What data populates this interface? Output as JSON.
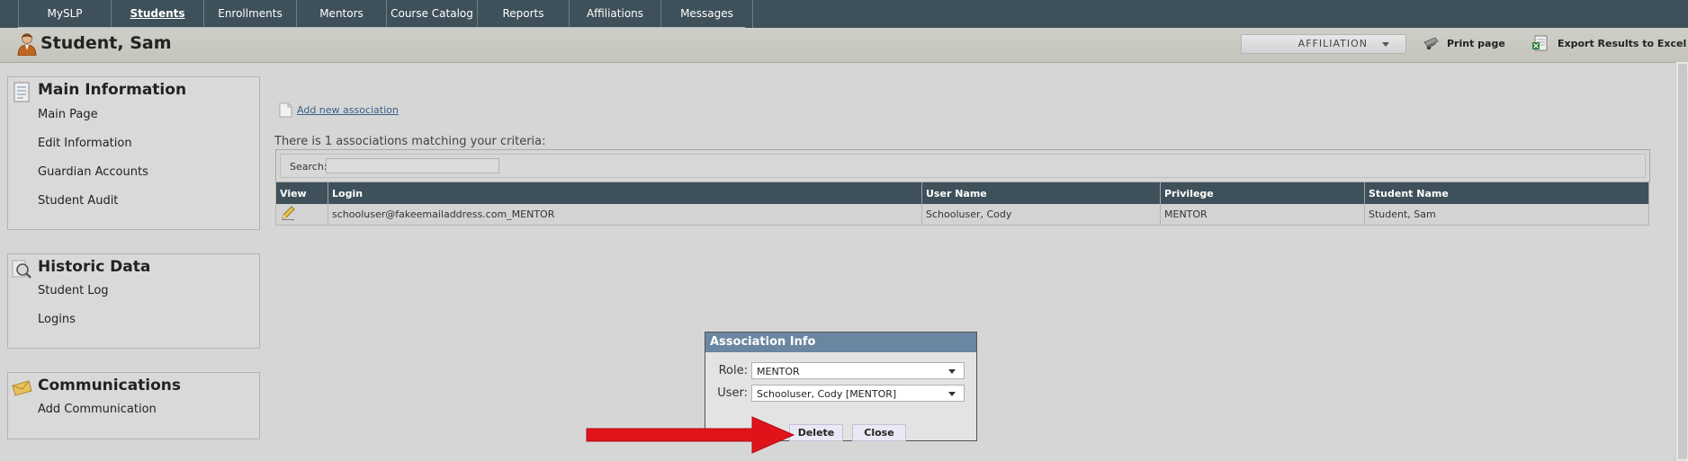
{
  "nav": {
    "tabs": [
      {
        "label": "MySLP"
      },
      {
        "label": "Students"
      },
      {
        "label": "Enrollments"
      },
      {
        "label": "Mentors"
      },
      {
        "label": "Course Catalog"
      },
      {
        "label": "Reports"
      },
      {
        "label": "Affiliations"
      },
      {
        "label": "Messages"
      }
    ],
    "active": "Students"
  },
  "header": {
    "title": "Student, Sam",
    "affiliation_label": "AFFILIATION",
    "print_label": "Print page",
    "export_label": "Export Results to Excel"
  },
  "sidebar": {
    "main_info": {
      "heading": "Main Information",
      "items": [
        "Main Page",
        "Edit Information",
        "Guardian Accounts",
        "Student Audit"
      ]
    },
    "historic": {
      "heading": "Historic Data",
      "items": [
        "Student Log",
        "Logins"
      ]
    },
    "communications": {
      "heading": "Communications",
      "items": [
        "Add Communication"
      ]
    }
  },
  "main": {
    "add_link": "Add new association",
    "count_text": "There is 1 associations matching your criteria:",
    "search_label": "Search:",
    "search_value": "",
    "columns": [
      "View",
      "Login",
      "User Name",
      "Privilege",
      "Student Name"
    ],
    "rows": [
      {
        "login": "schooluser@fakeemailaddress.com_MENTOR",
        "user_name": "Schooluser, Cody",
        "privilege": "MENTOR",
        "student_name": "Student, Sam"
      }
    ]
  },
  "dialog": {
    "title": "Association Info",
    "role_label": "Role:",
    "role_value": "MENTOR",
    "user_label": "User:",
    "user_value": "Schooluser, Cody [MENTOR]",
    "delete_label": "Delete",
    "close_label": "Close"
  },
  "colors": {
    "nav_bg": "#3e5059",
    "dialog_header": "#6b86a1",
    "arrow": "#e0131a",
    "link": "#3a5f8a"
  }
}
